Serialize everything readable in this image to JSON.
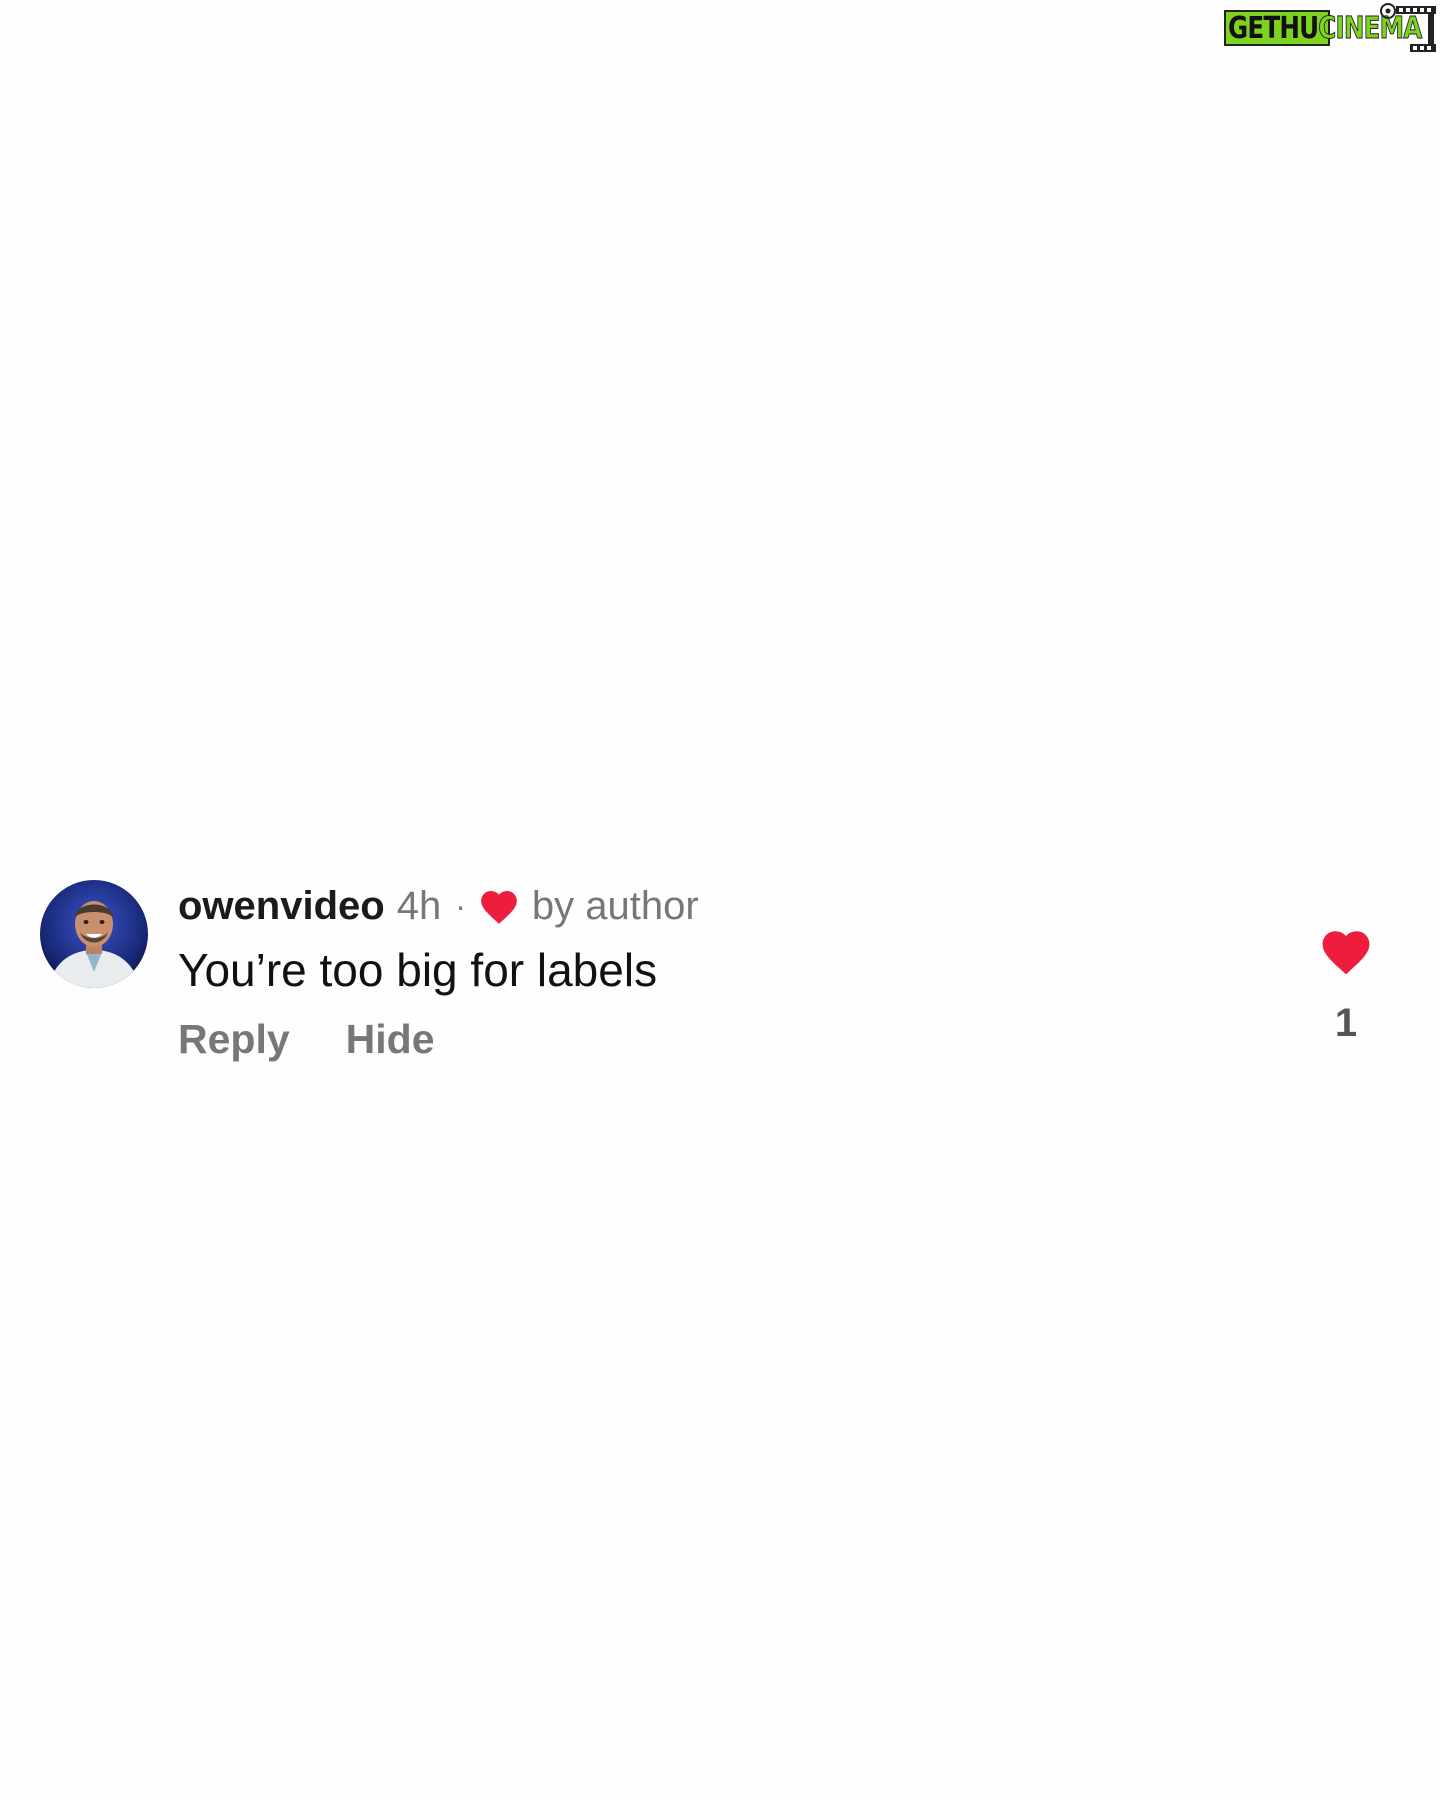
{
  "watermark": {
    "brand_part1": "GETHU",
    "brand_part2": "CINEMA",
    "icon": "film-camera-icon",
    "colors": {
      "green": "#7ed321",
      "dark": "#222222"
    }
  },
  "comment": {
    "username": "owenvideo",
    "timestamp": "4h",
    "separator": "·",
    "author_heart_icon": "heart-icon",
    "author_like_label": "by author",
    "text": "You’re too big for labels",
    "actions": {
      "reply_label": "Reply",
      "hide_label": "Hide"
    },
    "like": {
      "icon": "heart-filled-icon",
      "count": "1",
      "liked": true
    }
  },
  "colors": {
    "heart_red": "#ee1d3d",
    "username": "#1b1b1b",
    "muted": "#777777",
    "background": "#fefefe"
  }
}
